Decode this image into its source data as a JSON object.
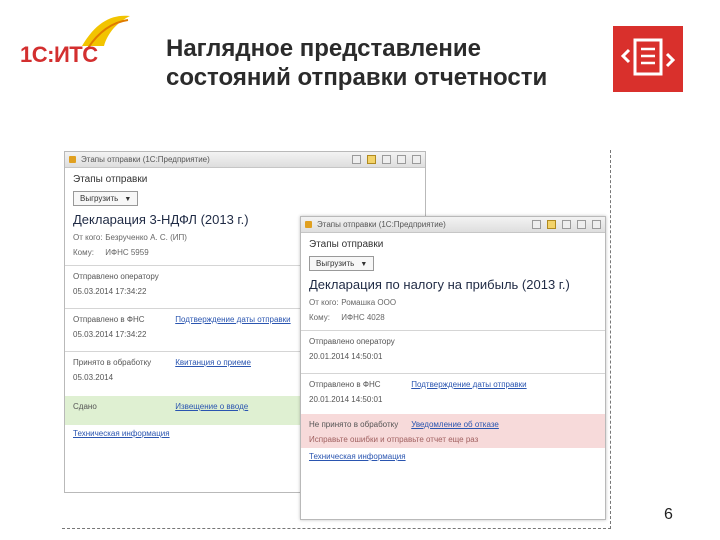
{
  "brand": {
    "logo_text": "1С:ИТС",
    "accent": "#d32f2f"
  },
  "slide": {
    "title": "Наглядное представление состояний отправки отчетности",
    "page_number": "6"
  },
  "window1": {
    "title": "Этапы отправки (1С:Предприятие)",
    "form_title": "Этапы отправки",
    "dropdown": "Выгрузить",
    "doc_title": "Декларация 3-НДФЛ (2013 г.)",
    "from_label": "От кого:",
    "from_value": "Безрученко А. С. (ИП)",
    "to_label": "Кому:",
    "to_value": "ИФНС 5959",
    "stages": [
      {
        "label": "Отправлено оператору",
        "link": "",
        "date": "05.03.2014 17:34:22",
        "status": "normal"
      },
      {
        "label": "Отправлено в ФНС",
        "link": "Подтверждение даты отправки",
        "date": "05.03.2014 17:34:22",
        "status": "normal"
      },
      {
        "label": "Принято в обработку",
        "link": "Квитанция о приеме",
        "date": "05.03.2014",
        "status": "normal"
      },
      {
        "label": "Сдано",
        "link": "Извещение о вводе",
        "date": "",
        "status": "success"
      }
    ],
    "tech_link": "Техническая информация"
  },
  "window2": {
    "title": "Этапы отправки (1С:Предприятие)",
    "form_title": "Этапы отправки",
    "dropdown": "Выгрузить",
    "doc_title": "Декларация по налогу на прибыль (2013 г.)",
    "from_label": "От кого:",
    "from_value": "Ромашка ООО",
    "to_label": "Кому:",
    "to_value": "ИФНС 4028",
    "stages": [
      {
        "label": "Отправлено оператору",
        "link": "",
        "date": "20.01.2014 14:50:01",
        "status": "normal"
      },
      {
        "label": "Отправлено в ФНС",
        "link": "Подтверждение даты отправки",
        "date": "20.01.2014 14:50:01",
        "status": "normal"
      },
      {
        "label": "Не принято в обработку",
        "link": "Уведомление об отказе",
        "date": "",
        "note": "Исправьте ошибки и отправьте отчет еще раз",
        "status": "error"
      }
    ],
    "tech_link": "Техническая информация"
  },
  "colors": {
    "success_bg": "#dff0d2",
    "error_bg": "#f7dada",
    "link": "#2a55b0",
    "corner_icon": "#d9302c"
  }
}
